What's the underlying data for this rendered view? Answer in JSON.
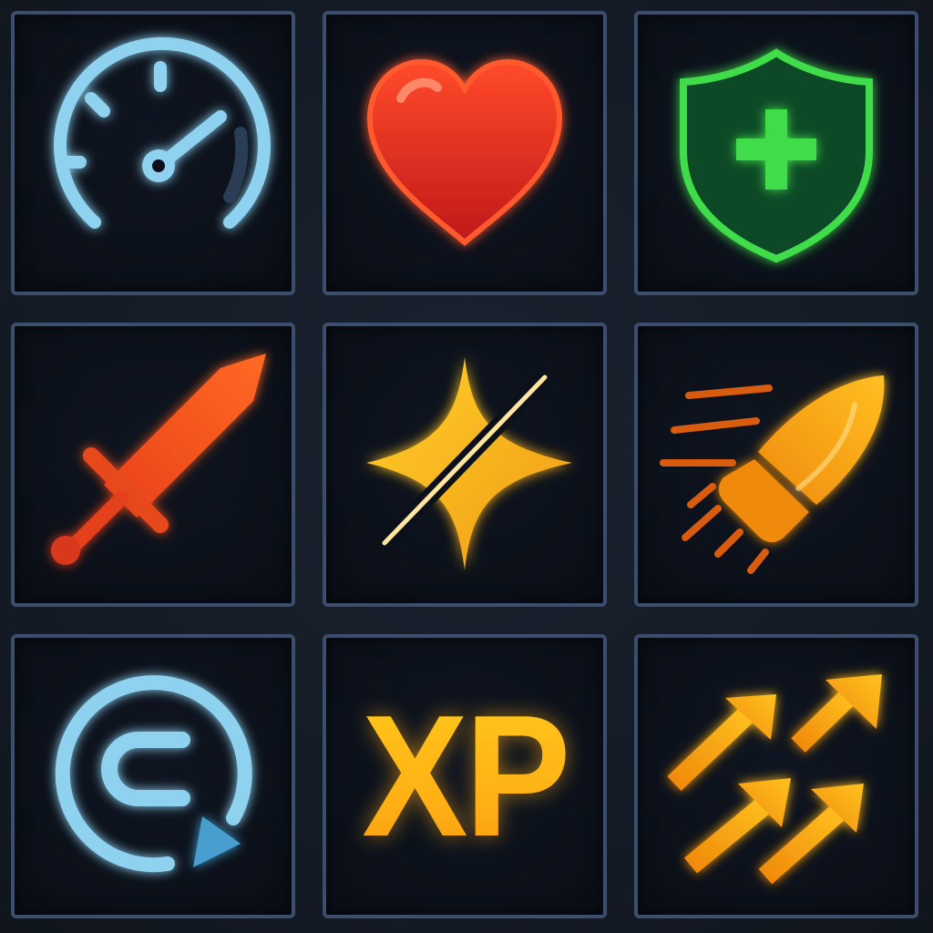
{
  "grid": {
    "tiles": [
      {
        "id": "speed",
        "icon": "speedometer-icon",
        "color": "#7fc8ea"
      },
      {
        "id": "health",
        "icon": "heart-icon",
        "color": "#e8321e"
      },
      {
        "id": "defense",
        "icon": "shield-plus-icon",
        "color": "#3fdc4a"
      },
      {
        "id": "attack",
        "icon": "sword-icon",
        "color": "#f05a1c"
      },
      {
        "id": "critical",
        "icon": "slash-sparkle-icon",
        "color": "#ffb81e"
      },
      {
        "id": "projectile",
        "icon": "bullet-icon",
        "color": "#f79b12"
      },
      {
        "id": "cooldown",
        "icon": "refresh-icon",
        "color": "#7fc8ea"
      },
      {
        "id": "experience",
        "icon": "xp-icon",
        "color": "#ffbf1a",
        "label": "XP"
      },
      {
        "id": "upgrade",
        "icon": "multi-arrow-up-icon",
        "color": "#ffa514"
      }
    ]
  },
  "frame": {
    "border_color": "#3b4e6e",
    "background": "#151b26"
  }
}
